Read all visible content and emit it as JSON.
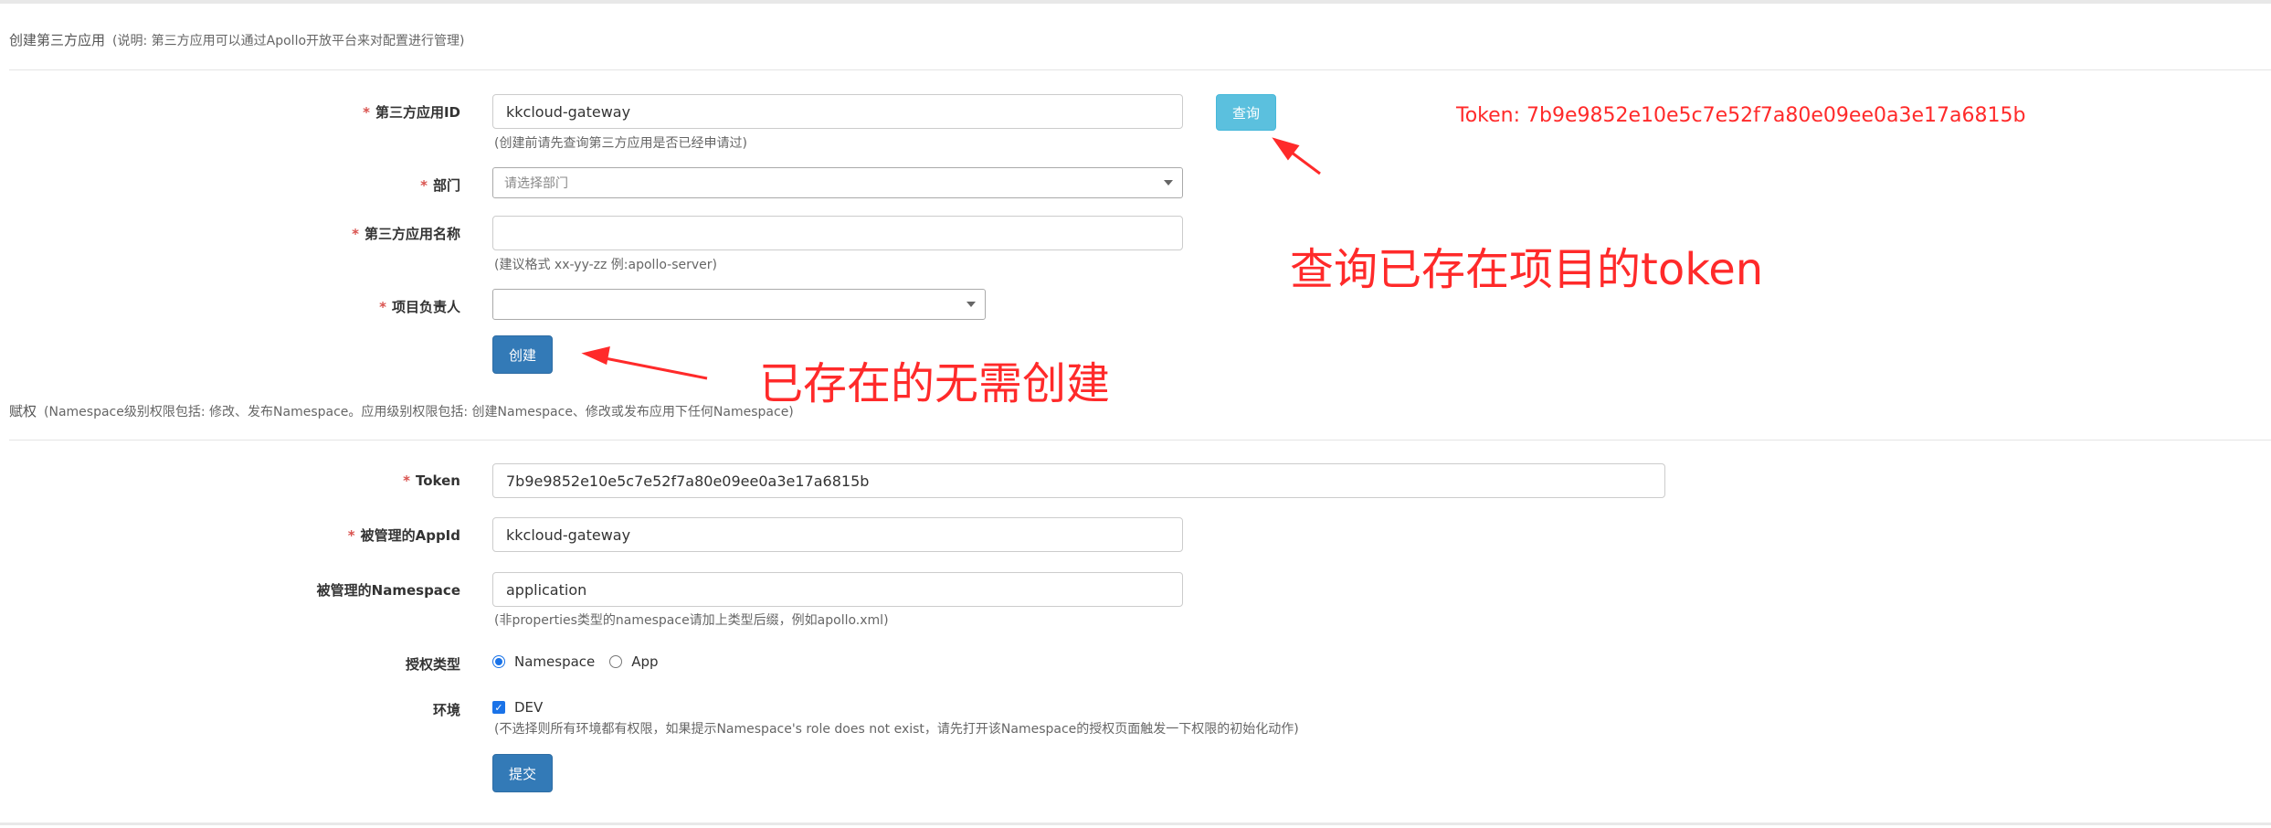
{
  "section1": {
    "title": "创建第三方应用",
    "note": "(说明: 第三方应用可以通过Apollo开放平台来对配置进行管理)"
  },
  "create_form": {
    "app_id": {
      "label": "第三方应用ID",
      "value": "kkcloud-gateway",
      "help": "(创建前请先查询第三方应用是否已经申请过)"
    },
    "query_button": "查询",
    "department": {
      "label": "部门",
      "placeholder": "请选择部门"
    },
    "app_name": {
      "label": "第三方应用名称",
      "value": "",
      "help": "(建议格式 xx-yy-zz 例:apollo-server)"
    },
    "owner": {
      "label": "项目负责人",
      "value": ""
    },
    "create_button": "创建",
    "required_mark": "*"
  },
  "section2": {
    "title": "赋权",
    "note": "(Namespace级别权限包括: 修改、发布Namespace。应用级别权限包括: 创建Namespace、修改或发布应用下任何Namespace)"
  },
  "grant_form": {
    "token": {
      "label": "Token",
      "value": "7b9e9852e10e5c7e52f7a80e09ee0a3e17a6815b"
    },
    "managed_appid": {
      "label": "被管理的AppId",
      "value": "kkcloud-gateway"
    },
    "managed_namespace": {
      "label": "被管理的Namespace",
      "value": "application",
      "help": "(非properties类型的namespace请加上类型后缀，例如apollo.xml)"
    },
    "grant_type": {
      "label": "授权类型",
      "options": [
        "Namespace",
        "App"
      ],
      "selected": "Namespace"
    },
    "env": {
      "label": "环境",
      "option": "DEV",
      "checked": true,
      "help": "(不选择则所有环境都有权限，如果提示Namespace's role does not exist，请先打开该Namespace的授权页面触发一下权限的初始化动作)"
    },
    "submit_button": "提交"
  },
  "annotations": {
    "token_result": "Token: 7b9e9852e10e5c7e52f7a80e09ee0a3e17a6815b",
    "query_hint": "查询已存在项目的token",
    "exists_hint": "已存在的无需创建",
    "color": "#ff2a2a"
  },
  "colors": {
    "primary": "#337ab7",
    "info": "#5bc0de",
    "required": "#d9534f"
  }
}
